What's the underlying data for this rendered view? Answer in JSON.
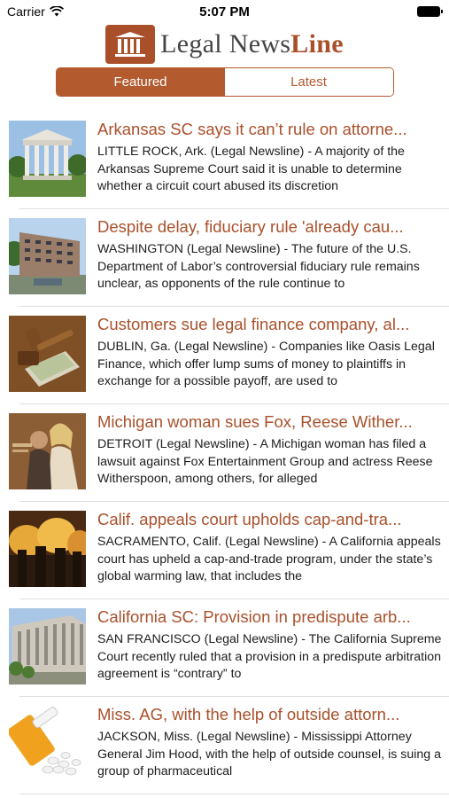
{
  "status_bar": {
    "carrier": "Carrier",
    "time": "5:07 PM"
  },
  "header": {
    "logo_prefix": "Legal News",
    "logo_suffix": "Line"
  },
  "tabs": [
    {
      "label": "Featured",
      "active": true
    },
    {
      "label": "Latest",
      "active": false
    }
  ],
  "articles": [
    {
      "title": "Arkansas SC says it can’t rule on attorne...",
      "body": "LITTLE ROCK, Ark. (Legal Newsline) - A majority of the Arkansas Supreme Court said it is unable to determine whether a circuit court abused its discretion",
      "thumb": "capitol-building"
    },
    {
      "title": "Despite delay, fiduciary rule 'already cau...",
      "body": "WASHINGTON (Legal Newsline) - The future of the U.S. Department of Labor’s controversial fiduciary rule remains unclear, as opponents of the rule continue to",
      "thumb": "office-building"
    },
    {
      "title": "Customers sue legal finance company, al...",
      "body": "DUBLIN, Ga. (Legal Newsline) - Companies like Oasis Legal Finance, which offer lump sums of money to plaintiffs in exchange for a possible payoff, are used to",
      "thumb": "gavel-money"
    },
    {
      "title": "Michigan woman sues Fox, Reese Wither...",
      "body": "DETROIT (Legal Newsline) - A Michigan woman has filed a lawsuit against Fox Entertainment Group and actress Reese Witherspoon, among others, for alleged",
      "thumb": "movie-poster"
    },
    {
      "title": "Calif. appeals court upholds cap-and-tra...",
      "body": "SACRAMENTO, Calif. (Legal Newsline) - A California appeals court has upheld a cap-and-trade program, under the state’s global warming law, that includes the",
      "thumb": "smokestacks"
    },
    {
      "title": "California SC: Provision in predispute arb...",
      "body": "SAN FRANCISCO (Legal Newsline) - The California Supreme Court recently ruled that a provision in a predispute arbitration agreement is “contrary” to",
      "thumb": "court-building"
    },
    {
      "title": "Miss. AG, with the help of outside attorn...",
      "body": "JACKSON, Miss. (Legal Newsline) - Mississippi Attorney General Jim Hood, with the help of outside counsel, is suing a group of pharmaceutical",
      "thumb": "pill-bottle"
    }
  ],
  "colors": {
    "accent": "#a9502b",
    "tab_active": "#b35a2e"
  }
}
